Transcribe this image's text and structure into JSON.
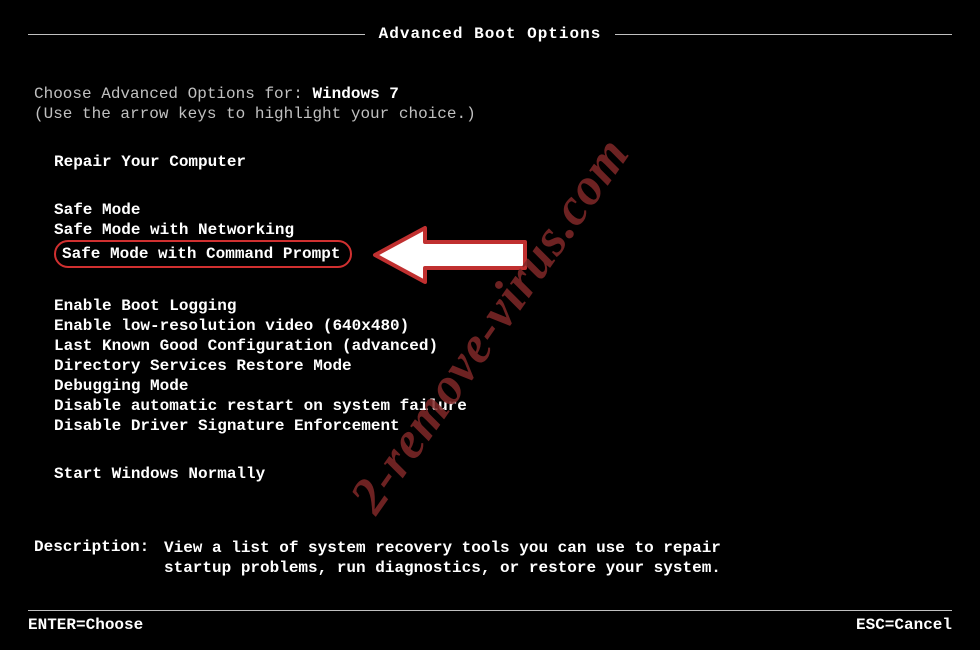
{
  "title": "Advanced Boot Options",
  "choose_prefix": "Choose Advanced Options for: ",
  "os_name": "Windows 7",
  "hint": "(Use the arrow keys to highlight your choice.)",
  "groups": {
    "repair": "Repair Your Computer",
    "safe": [
      "Safe Mode",
      "Safe Mode with Networking",
      "Safe Mode with Command Prompt"
    ],
    "other": [
      "Enable Boot Logging",
      "Enable low-resolution video (640x480)",
      "Last Known Good Configuration (advanced)",
      "Directory Services Restore Mode",
      "Debugging Mode",
      "Disable automatic restart on system failure",
      "Disable Driver Signature Enforcement"
    ],
    "normal": "Start Windows Normally"
  },
  "selected_index": 2,
  "description": {
    "label": "Description:",
    "text": "View a list of system recovery tools you can use to repair startup problems, run diagnostics, or restore your system."
  },
  "footer": {
    "enter": "ENTER=Choose",
    "esc": "ESC=Cancel"
  },
  "watermark": "2-remove-virus.com",
  "colors": {
    "highlight_border": "#d03030",
    "text": "#c0c0c0"
  }
}
